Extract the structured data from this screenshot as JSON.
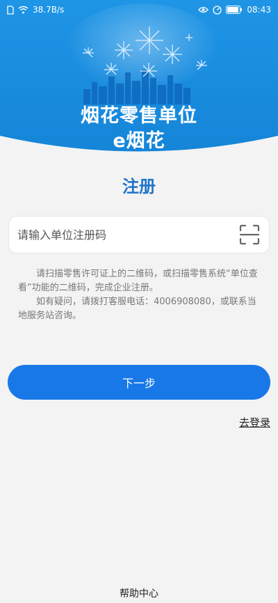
{
  "status_bar": {
    "network_speed": "38.7B/s",
    "battery_level": "81",
    "time": "08:43",
    "icons": [
      "sim-icon",
      "wifi-icon",
      "eye-icon",
      "speed-icon",
      "battery-icon"
    ]
  },
  "header": {
    "title_line1": "烟花零售单位",
    "title_line2": "e烟花",
    "background_color": "#1a8fe0"
  },
  "page_title": "注册",
  "form": {
    "code_placeholder": "请输入单位注册码",
    "code_value": ""
  },
  "hint": {
    "line1": "请扫描零售许可证上的二维码，或扫描零售系统“单位查看”功能的二维码，完成企业注册。",
    "line2": "如有疑问，请拨打客服电话：4006908080，或联系当地服务站咨询。"
  },
  "buttons": {
    "next_label": "下一步",
    "login_label": "去登录",
    "help_label": "帮助中心"
  },
  "colors": {
    "accent": "#1878e8",
    "title": "#1f73c9"
  }
}
